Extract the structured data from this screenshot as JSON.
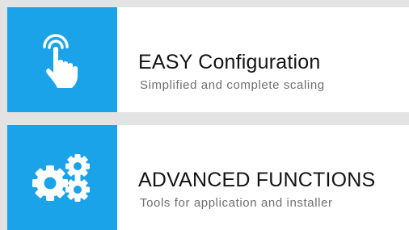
{
  "features": [
    {
      "icon": "touch-hand-icon",
      "title": "EASY Configuration",
      "subtitle": "Simplified and complete scaling"
    },
    {
      "icon": "gears-icon",
      "title": "ADVANCED FUNCTIONS",
      "subtitle": "Tools for application and installer"
    }
  ],
  "colors": {
    "accent": "#1aa3e8",
    "background": "#e3e3e3",
    "card": "#ffffff",
    "title": "#141414",
    "subtitle": "#6f6f6f"
  }
}
